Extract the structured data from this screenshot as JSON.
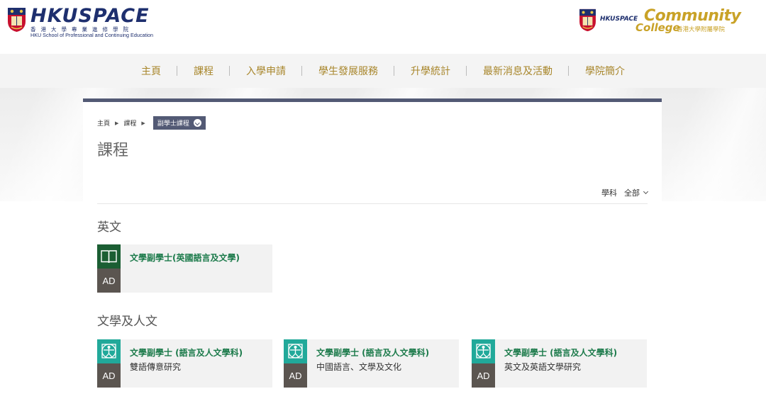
{
  "header": {
    "left_logo": {
      "wordmark": "HKUSPACE",
      "chinese": "香港大學專業進修學院",
      "english": "HKU School of Professional and Continuing Education"
    },
    "right_logo": {
      "prefix": "HKUSPACE",
      "community": "Community",
      "college": "College",
      "chinese": "香港大學附屬學院"
    }
  },
  "nav": {
    "items": [
      {
        "label": "主頁"
      },
      {
        "label": "課程"
      },
      {
        "label": "入學申請"
      },
      {
        "label": "學生發展服務"
      },
      {
        "label": "升學統計"
      },
      {
        "label": "最新消息及活動"
      },
      {
        "label": "學院簡介"
      }
    ]
  },
  "breadcrumb": {
    "items": [
      "主頁",
      "課程"
    ],
    "current": "副學士課程"
  },
  "page_title": "課程",
  "filter": {
    "label": "學科",
    "value": "全部"
  },
  "sections": [
    {
      "title": "英文",
      "courses": [
        {
          "title": "文學副學士(英國語言及文學)",
          "subtitle": "",
          "badge": "AD",
          "icon": "book-icon",
          "icon_color": "#1b5e33"
        }
      ]
    },
    {
      "title": "文學及人文",
      "courses": [
        {
          "title": "文學副學士 (語言及人文學科)",
          "subtitle": "雙語傳意研究",
          "badge": "AD",
          "icon": "vitruvian-icon",
          "icon_color": "#21a99a"
        },
        {
          "title": "文學副學士 (語言及人文學科)",
          "subtitle": "中國語言、文學及文化",
          "badge": "AD",
          "icon": "vitruvian-icon",
          "icon_color": "#21a99a"
        },
        {
          "title": "文學副學士 (語言及人文學科)",
          "subtitle": "英文及英語文學研究",
          "badge": "AD",
          "icon": "vitruvian-icon",
          "icon_color": "#21a99a"
        }
      ]
    }
  ],
  "colors": {
    "nav_text": "#a8862b",
    "card_accent": "#535a75",
    "course_title": "#1b7a4a",
    "badge_bg": "#5b5550"
  }
}
